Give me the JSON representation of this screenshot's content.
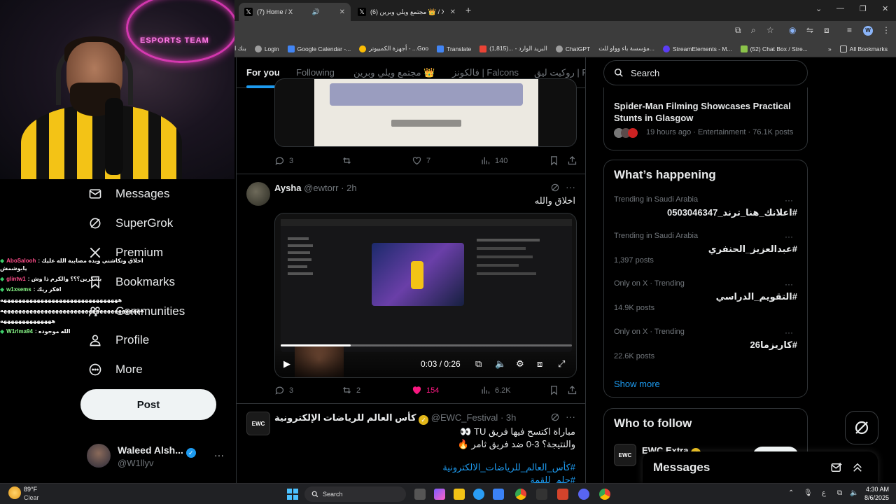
{
  "browser": {
    "tabs": [
      {
        "title": "(7) Home / X",
        "active": true
      },
      {
        "title": "(6) مجتمع ويلي وبرين 👑 / X"
      }
    ],
    "bookmarks": [
      {
        "label": "بنك ا",
        "color": "#4caf50"
      },
      {
        "label": "Login",
        "color": "#9e9e9e"
      },
      {
        "label": "Google Calendar -...",
        "color": "#4285f4"
      },
      {
        "label": "أجهزة الكمبيوتر - ...Goo",
        "color": "#fbbc04"
      },
      {
        "label": "Translate",
        "color": "#4285f4"
      },
      {
        "label": "البريد الوارد - ...(1,815)",
        "color": "#ea4335"
      },
      {
        "label": "ChatGPT",
        "color": "#9e9e9e"
      },
      {
        "label": "مؤسسة باء وواو للت...",
        "color": "#e0e0e0"
      },
      {
        "label": "StreamElements - M...",
        "color": "#5b3df5"
      },
      {
        "label": "(52) Chat Box / Stre...",
        "color": "#8bc34a"
      }
    ],
    "all_bookmarks": "All Bookmarks",
    "profile_initial": "W"
  },
  "stream_chat": [
    {
      "user": "AboSalooh",
      "msg": ": اخلاق وتكاشني وبده مصابية الله عليك",
      "extra": "يابوشمش"
    },
    {
      "user": "glintw1",
      "msg": ": بشكرين؟؟؟ والكرم ذا وش"
    },
    {
      "user": "w1xsems",
      "msg": ": افكر ريك"
    },
    {
      "user": "",
      "msg": "ههههههههههههههههههههههههههههههههه"
    },
    {
      "user": "",
      "msg": "ههههههههههههههههههههههههههههههههههههههه"
    },
    {
      "user": "",
      "msg": "ههههههههههههههه"
    },
    {
      "user": "W1rlma94",
      "msg": ": الله موجوده"
    }
  ],
  "nav": [
    {
      "label": "Messages",
      "icon": "envelope-icon"
    },
    {
      "label": "SuperGrok",
      "icon": "grok-icon"
    },
    {
      "label": "Premium",
      "icon": "x-logo-icon"
    },
    {
      "label": "Bookmarks",
      "icon": "bookmark-icon"
    },
    {
      "label": "Communities",
      "icon": "communities-icon"
    },
    {
      "label": "Profile",
      "icon": "person-icon"
    },
    {
      "label": "More",
      "icon": "more-circle-icon"
    }
  ],
  "post_button": "Post",
  "account": {
    "name": "Waleed Alsh...",
    "handle": "@W1llyv"
  },
  "timeline": {
    "tabs": [
      "For you",
      "Following",
      "مجتمع ويلي وبرين 👑",
      "فالكونز | Falcons",
      "روكيت ليق | RL"
    ],
    "first_card_stats": {
      "replies": "3",
      "reposts": "",
      "likes": "7",
      "views": "140"
    },
    "tweet1": {
      "name": "Aysha",
      "handle": "@ewtorr",
      "time": "2h",
      "text": "اخلاق والله",
      "video_time": "0:03 / 0:26",
      "video_progress": 0.24,
      "stats": {
        "replies": "3",
        "reposts": "2",
        "likes": "154",
        "views": "6.2K"
      }
    },
    "tweet2": {
      "name": "كأس العالم للرياضات الإلكترونية",
      "handle": "@EWC_Festival",
      "time": "3h",
      "line1": "مباراة اكتسح فيها فريق TU 👀",
      "line2": "والنتيجة؟ 3-0 ضد فريق ثامر 🔥",
      "tag1": "#كأس_العالم_للرياضات_الالكترونية",
      "tag2": "#حلم_للقمة"
    }
  },
  "right": {
    "search_placeholder": "Search",
    "news": {
      "title": "Spider-Man Filming Showcases Practical Stunts in Glasgow",
      "meta": "19 hours ago · Entertainment · 76.1K posts"
    },
    "whats_happening": "What’s happening",
    "trends": [
      {
        "cat": "Trending in Saudi Arabia",
        "title": "#اعلانك_هنا_ترند_0503046347",
        "count": ""
      },
      {
        "cat": "Trending in Saudi Arabia",
        "title": "#عبدالعزيز_الحنفري",
        "count": "1,397 posts"
      },
      {
        "cat": "Only on X · Trending",
        "title": "#التقويم_الدراسي",
        "count": "14.9K posts"
      },
      {
        "cat": "Only on X · Trending",
        "title": "#كاريزما26",
        "count": "22.6K posts"
      }
    ],
    "show_more": "Show more",
    "who_to_follow": "Who to follow",
    "follow_suggestion": {
      "name": "EWC Extra"
    },
    "messages": "Messages"
  },
  "taskbar": {
    "weather_temp": "89°F",
    "weather_desc": "Clear",
    "search": "Search",
    "time": "4:30 AM",
    "date": "8/6/2025",
    "lang": "ع"
  }
}
